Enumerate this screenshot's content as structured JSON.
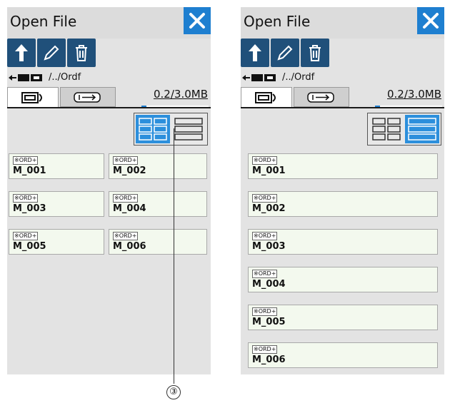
{
  "panels": [
    {
      "title": "Open File",
      "path": "/../Ordf",
      "capacity": "0.2/3.0MB",
      "capacity_fraction": 0.07,
      "view_mode": "grid",
      "files": [
        {
          "badge": "ORD+",
          "name": "M_001"
        },
        {
          "badge": "ORD+",
          "name": "M_002"
        },
        {
          "badge": "ORD+",
          "name": "M_003"
        },
        {
          "badge": "ORD+",
          "name": "M_004"
        },
        {
          "badge": "ORD+",
          "name": "M_005"
        },
        {
          "badge": "ORD+",
          "name": "M_006"
        }
      ]
    },
    {
      "title": "Open File",
      "path": "/../Ordf",
      "capacity": "0.2/3.0MB",
      "capacity_fraction": 0.07,
      "view_mode": "list",
      "files": [
        {
          "badge": "ORD+",
          "name": "M_001"
        },
        {
          "badge": "ORD+",
          "name": "M_002"
        },
        {
          "badge": "ORD+",
          "name": "M_003"
        },
        {
          "badge": "ORD+",
          "name": "M_004"
        },
        {
          "badge": "ORD+",
          "name": "M_005"
        },
        {
          "badge": "ORD+",
          "name": "M_006"
        }
      ]
    }
  ],
  "toolbar_icons": [
    "up-arrow-icon",
    "pencil-icon",
    "trash-icon"
  ],
  "callout": {
    "label": "③"
  },
  "colors": {
    "accent": "#1e7fd0",
    "toolbar": "#20507a",
    "card": "#f3f9ee"
  }
}
